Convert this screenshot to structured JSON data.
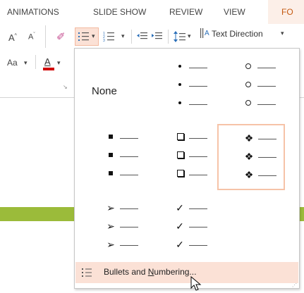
{
  "ribbon": {
    "tabs": [
      {
        "label": "ANIMATIONS"
      },
      {
        "label": "SLIDE SHOW"
      },
      {
        "label": "REVIEW"
      },
      {
        "label": "VIEW"
      },
      {
        "label": "FO"
      }
    ],
    "text_direction_label": "Text Direction",
    "font_case_label": "Aa",
    "dropdown_arrow": "▾"
  },
  "bullet_library": {
    "none_label": "None",
    "styles": [
      {
        "name": "none"
      },
      {
        "name": "filled-round-bullets",
        "glyph": "•"
      },
      {
        "name": "hollow-round-bullets",
        "glyph": "o"
      },
      {
        "name": "filled-square-bullets",
        "glyph": "▪"
      },
      {
        "name": "hollow-square-bullets",
        "glyph": "❑"
      },
      {
        "name": "star-bullets",
        "glyph": "❖",
        "selected": true
      },
      {
        "name": "arrow-bullets",
        "glyph": "➢"
      },
      {
        "name": "checkmark-bullets",
        "glyph": "✓"
      }
    ],
    "footer_label_prefix": "Bullets and ",
    "footer_label_underlined": "N",
    "footer_label_suffix": "umbering..."
  },
  "colors": {
    "selected_border": "#f6c3a8",
    "hover_background": "#fbe1d6",
    "accent_green": "#9bbb3a",
    "font_color_red": "#d00000"
  }
}
